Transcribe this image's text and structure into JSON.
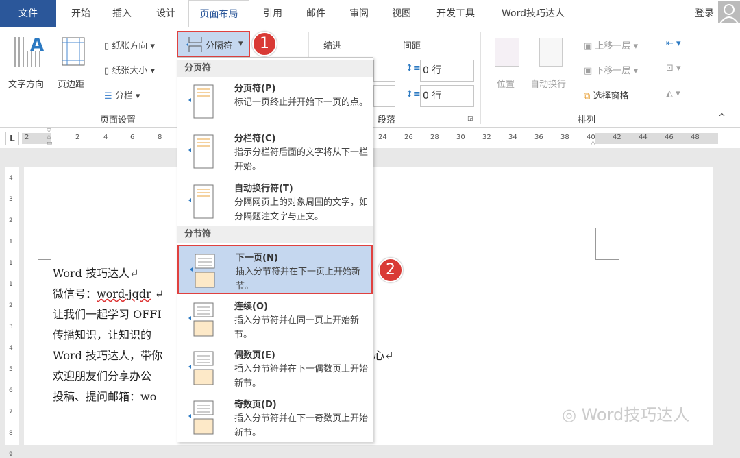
{
  "tabs": [
    "文件",
    "开始",
    "插入",
    "设计",
    "页面布局",
    "引用",
    "邮件",
    "审阅",
    "视图",
    "开发工具",
    "Word技巧达人"
  ],
  "login": "登录",
  "ribbon": {
    "text_direction": "文字方向",
    "margins": "页边距",
    "orientation": "纸张方向",
    "size": "纸张大小",
    "columns": "分栏",
    "breaks": "分隔符",
    "page_setup": "页面设置",
    "indent": "缩进",
    "spacing": "间距",
    "spacing_before": "0 行",
    "spacing_after": "0 行",
    "paragraph": "段落",
    "position": "位置",
    "wrap_text": "自动换行",
    "bring_forward": "上移一层",
    "send_backward": "下移一层",
    "selection_pane": "选择窗格",
    "arrange": "排列"
  },
  "ruler": {
    "left": [
      "2",
      "2",
      "4",
      "6",
      "8"
    ],
    "right": [
      "24",
      "26",
      "28",
      "30",
      "32",
      "34",
      "36",
      "38",
      "40",
      "42",
      "44",
      "46",
      "48"
    ],
    "vertical": [
      "4",
      "3",
      "2",
      "1",
      "1",
      "1",
      "2",
      "3",
      "4",
      "5",
      "6",
      "7",
      "8",
      "9"
    ],
    "corner": "L"
  },
  "document": {
    "lines": [
      "Word 技巧达人↵",
      "微信号：word-jqdr ↵",
      "让我们一起学习 OFFI",
      "传播知识，让知识的",
      "Word 技巧达人，带你",
      "欢迎朋友们分享办公",
      "投稿、提问邮箱：wo"
    ],
    "line5_tail": "心↵"
  },
  "menu": {
    "page_breaks_header": "分页符",
    "section_breaks_header": "分节符",
    "items": [
      {
        "title": "分页符(P)",
        "desc": "标记一页终止并开始下一页的点。"
      },
      {
        "title": "分栏符(C)",
        "desc": "指示分栏符后面的文字将从下一栏开始。"
      },
      {
        "title": "自动换行符(T)",
        "desc": "分隔网页上的对象周围的文字，如分隔题注文字与正文。"
      },
      {
        "title": "下一页(N)",
        "desc": "插入分节符并在下一页上开始新节。"
      },
      {
        "title": "连续(O)",
        "desc": "插入分节符并在同一页上开始新节。"
      },
      {
        "title": "偶数页(E)",
        "desc": "插入分节符并在下一偶数页上开始新节。"
      },
      {
        "title": "奇数页(D)",
        "desc": "插入分节符并在下一奇数页上开始新节。"
      }
    ]
  },
  "badges": [
    "1",
    "2"
  ],
  "watermark": "Word技巧达人",
  "colors": {
    "accent": "#2b579a",
    "highlight": "#c5d7ef",
    "callout": "#d93a35"
  }
}
